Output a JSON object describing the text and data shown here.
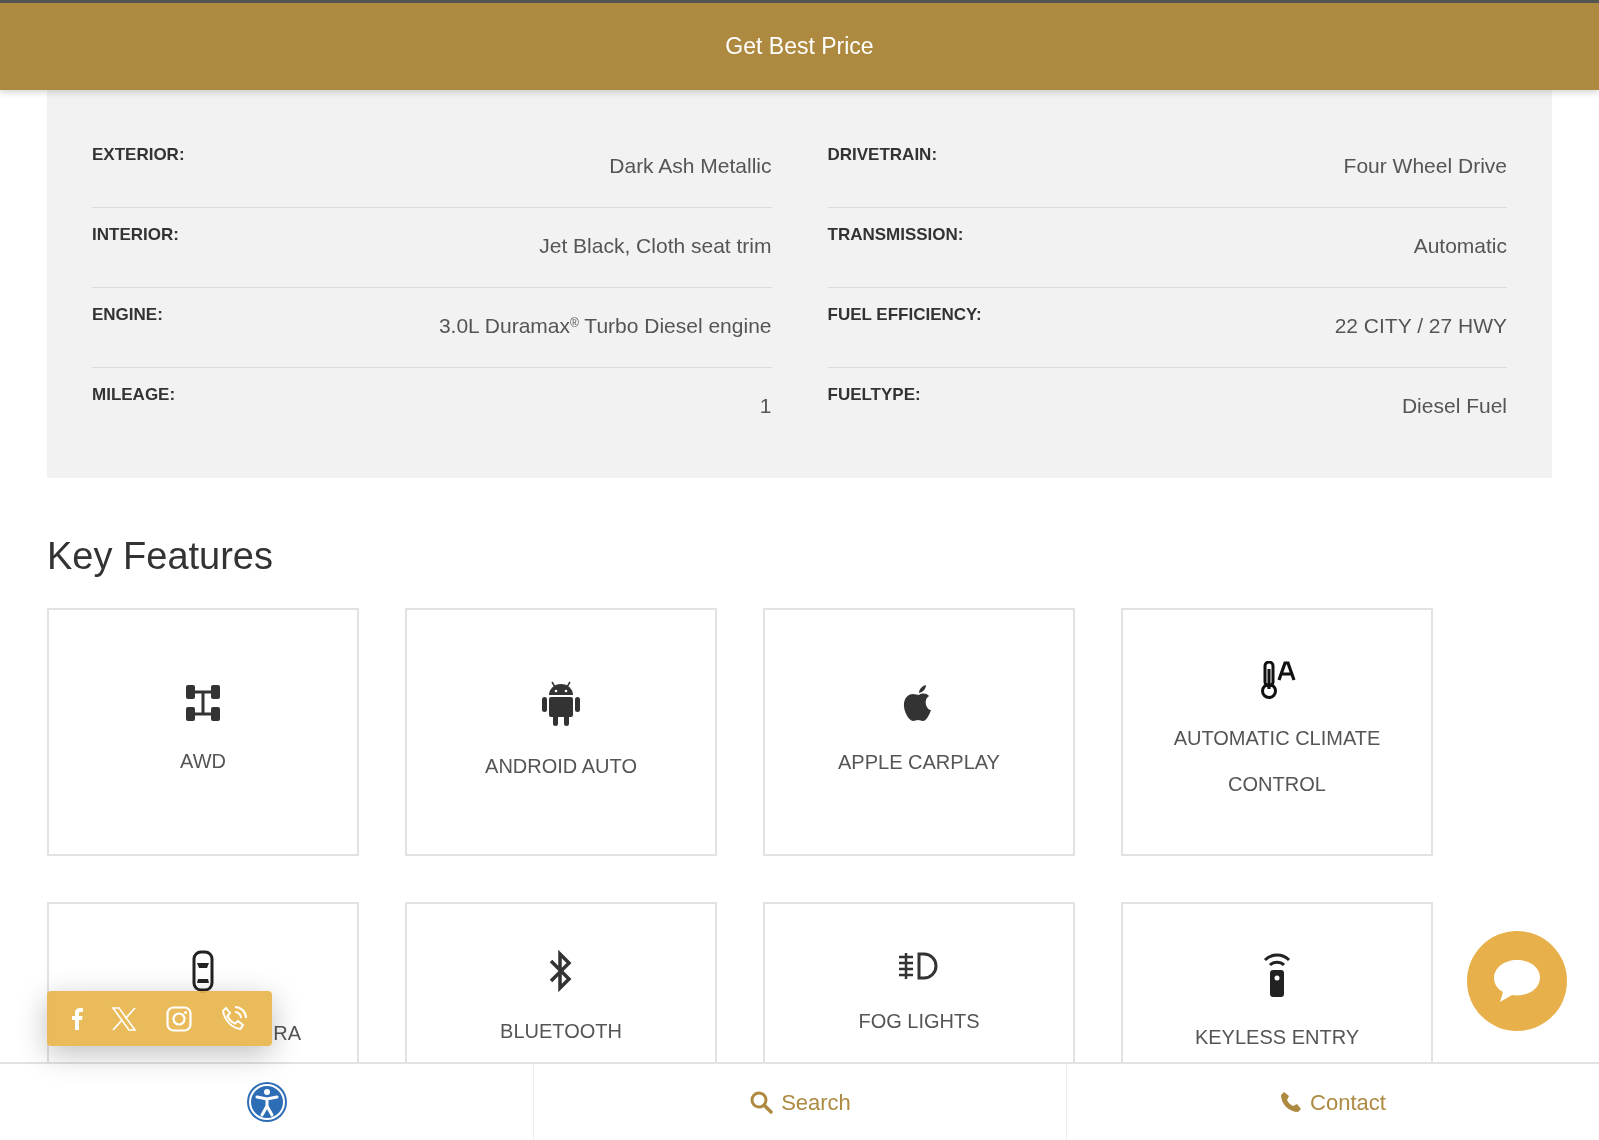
{
  "cta": {
    "label": "Get Best Price"
  },
  "specs": {
    "columns": [
      [
        {
          "label": "EXTERIOR:",
          "value": "Dark Ash Metallic"
        },
        {
          "label": "INTERIOR:",
          "value": "Jet Black, Cloth seat trim"
        },
        {
          "label": "ENGINE:",
          "value": "3.0L Duramax$^{®}$ Turbo Diesel engine"
        },
        {
          "label": "MILEAGE:",
          "value": "1"
        }
      ],
      [
        {
          "label": "DRIVETRAIN:",
          "value": "Four Wheel Drive"
        },
        {
          "label": "TRANSMISSION:",
          "value": "Automatic"
        },
        {
          "label": "FUEL EFFICIENCY:",
          "value": "22 CITY / 27 HWY"
        },
        {
          "label": "FUELTYPE:",
          "value": "Diesel Fuel"
        }
      ]
    ]
  },
  "features": {
    "title": "Key Features",
    "items": [
      {
        "label": "AWD"
      },
      {
        "label": "ANDROID AUTO"
      },
      {
        "label": "APPLE CARPLAY"
      },
      {
        "label": "AUTOMATIC CLIMATE CONTROL"
      },
      {
        "label": "RA",
        "kind": "partly_hidden"
      },
      {
        "label": "BLUETOOTH"
      },
      {
        "label": "FOG LIGHTS"
      },
      {
        "label": "KEYLESS ENTRY"
      }
    ]
  },
  "bottom_nav": [
    {
      "label": "Search"
    },
    {
      "label": "Contact"
    }
  ]
}
